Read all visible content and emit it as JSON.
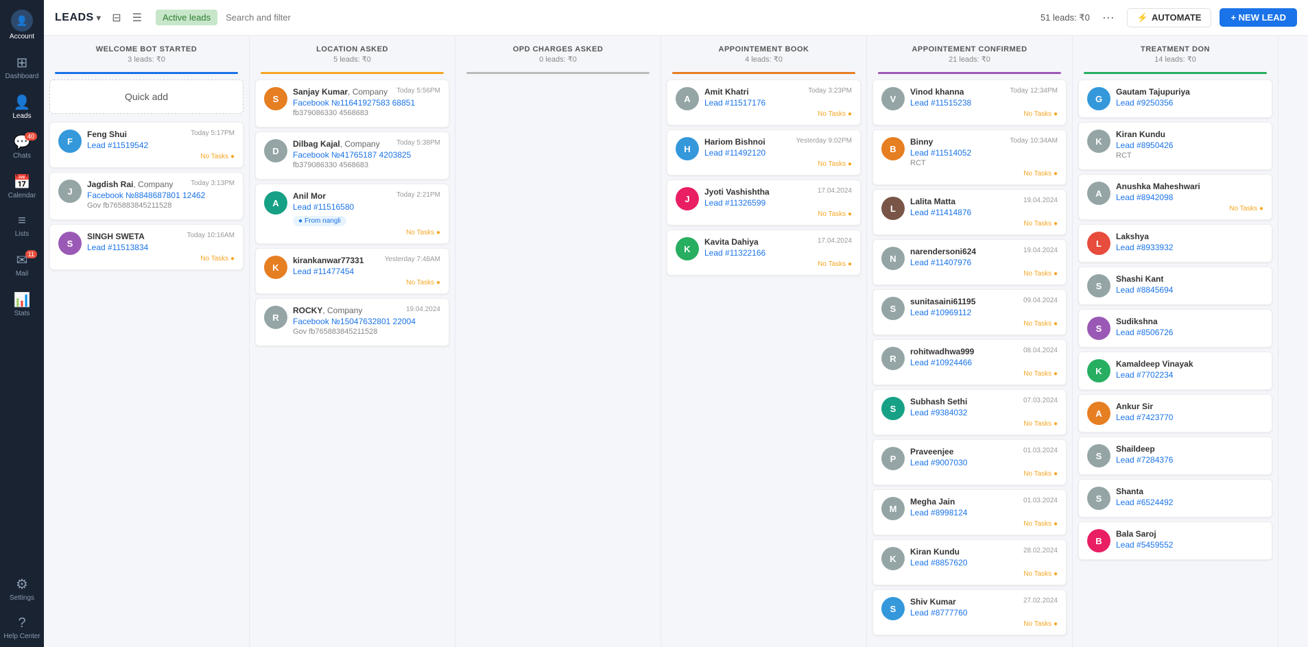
{
  "sidebar": {
    "account_label": "Account",
    "items": [
      {
        "id": "dashboard",
        "label": "Dashboard",
        "icon": "⊞"
      },
      {
        "id": "leads",
        "label": "Leads",
        "icon": "👤",
        "active": true
      },
      {
        "id": "chats",
        "label": "Chats",
        "icon": "💬",
        "badge": "40"
      },
      {
        "id": "calendar",
        "label": "Calendar",
        "icon": "📅"
      },
      {
        "id": "lists",
        "label": "Lists",
        "icon": "≡"
      },
      {
        "id": "mail",
        "label": "Mail",
        "icon": "✉",
        "badge": "11"
      },
      {
        "id": "stats",
        "label": "Stats",
        "icon": "📊"
      },
      {
        "id": "settings",
        "label": "Settings",
        "icon": "⚙"
      },
      {
        "id": "help",
        "label": "Help Center",
        "icon": "?"
      }
    ]
  },
  "topbar": {
    "title": "LEADS",
    "active_filter": "Active leads",
    "search_placeholder": "Search and filter",
    "leads_count": "51 leads: ₹0",
    "automate_label": "AUTOMATE",
    "new_lead_label": "+ NEW LEAD"
  },
  "columns": [
    {
      "id": "welcome-bot",
      "title": "WELCOME BOT STARTED",
      "subtitle": "3 leads: ₹0",
      "line_color": "#1a73e8",
      "cards": [
        {
          "type": "quick-add",
          "label": "Quick add"
        },
        {
          "name": "Feng Shui",
          "time": "Today 5:17PM",
          "lead": "Lead #11519542",
          "tasks": "No Tasks",
          "avatar_char": "F",
          "avatar_color": "av-blue"
        },
        {
          "name": "Jagdish Rai",
          "name_suffix": ", Company",
          "time": "Today 3:13PM",
          "lead": "Facebook №8848687801 12462",
          "sub": "Gov  fb765883845211528",
          "avatar_char": "J",
          "avatar_color": "av-gray"
        },
        {
          "name": "SINGH SWETA",
          "time": "Today 10:16AM",
          "lead": "Lead #11513834",
          "tasks": "No Tasks",
          "avatar_char": "S",
          "avatar_color": "av-purple",
          "has_img": true
        }
      ]
    },
    {
      "id": "location-asked",
      "title": "LOCATION ASKED",
      "subtitle": "5 leads: ₹0",
      "line_color": "#f5a623",
      "cards": [
        {
          "name": "Sanjay Kumar",
          "name_suffix": ", Company",
          "time": "Today 5:56PM",
          "lead": "Facebook №11641927583 68851",
          "sub": "fb379086330 4568683",
          "avatar_char": "S",
          "avatar_color": "av-orange"
        },
        {
          "name": "Dilbag Kajal",
          "name_suffix": ", Company",
          "time": "Today 5:38PM",
          "lead": "Facebook №41765187 4203825",
          "sub": "fb379086330 4568683",
          "avatar_char": "D",
          "avatar_color": "av-gray"
        },
        {
          "name": "Anil Mor",
          "time": "Today 2:21PM",
          "lead": "Lead #11516580",
          "tasks": "No Tasks",
          "tag": "From nangli",
          "avatar_char": "A",
          "avatar_color": "av-teal",
          "has_img": true
        },
        {
          "name": "kirankanwar77331",
          "time": "Yesterday 7:48AM",
          "lead": "Lead #11477454",
          "tasks": "No Tasks",
          "avatar_char": "K",
          "avatar_color": "av-orange",
          "has_img": true
        },
        {
          "name": "ROCKY",
          "name_suffix": ", Company",
          "time": "19.04.2024",
          "lead": "Facebook №15047632801 22004",
          "sub": "Gov  fb765883845211528",
          "avatar_char": "R",
          "avatar_color": "av-gray"
        }
      ]
    },
    {
      "id": "opd-charges",
      "title": "OPD CHARGES ASKED",
      "subtitle": "0 leads: ₹0",
      "line_color": "#bbb",
      "cards": []
    },
    {
      "id": "appointement-book",
      "title": "APPOINTEMENT BOOK",
      "subtitle": "4 leads: ₹0",
      "line_color": "#e67e22",
      "cards": [
        {
          "name": "Amit Khatri",
          "time": "Today 3:23PM",
          "lead": "Lead #11517176",
          "tasks": "No Tasks",
          "avatar_char": "A",
          "avatar_color": "av-gray"
        },
        {
          "name": "Hariom Bishnoi",
          "time": "Yesterday 9:02PM",
          "lead": "Lead #11492120",
          "tasks": "No Tasks",
          "avatar_char": "H",
          "avatar_color": "av-blue",
          "has_img": true
        },
        {
          "name": "Jyoti Vashishtha",
          "time": "17.04.2024",
          "lead": "Lead #11326599",
          "tasks": "No Tasks",
          "avatar_char": "J",
          "avatar_color": "av-pink",
          "has_img": true
        },
        {
          "name": "Kavita Dahiya",
          "time": "17.04.2024",
          "lead": "Lead #11322166",
          "tasks": "No Tasks",
          "avatar_char": "K",
          "avatar_color": "av-green",
          "has_img": true
        }
      ]
    },
    {
      "id": "appointement-confirmed",
      "title": "APPOINTEMENT CONFIRMED",
      "subtitle": "21 leads: ₹0",
      "line_color": "#9b59b6",
      "cards": [
        {
          "name": "Vinod khanna",
          "time": "Today 12:34PM",
          "lead": "Lead #11515238",
          "tasks": "No Tasks",
          "avatar_char": "V",
          "avatar_color": "av-gray"
        },
        {
          "name": "Binny",
          "time": "Today 10:34AM",
          "lead": "Lead #11514052",
          "sub": "RCT",
          "tasks": "No Tasks",
          "avatar_char": "B",
          "avatar_color": "av-orange",
          "has_img": true
        },
        {
          "name": "Lalita Matta",
          "time": "19.04.2024",
          "lead": "Lead #11414876",
          "tasks": "No Tasks",
          "avatar_char": "L",
          "avatar_color": "av-brown",
          "has_img": true
        },
        {
          "name": "narendersoni624",
          "time": "19.04.2024",
          "lead": "Lead #11407976",
          "tasks": "No Tasks",
          "avatar_char": "N",
          "avatar_color": "av-gray"
        },
        {
          "name": "sunitasaini61195",
          "time": "09.04.2024",
          "lead": "Lead #10969112",
          "tasks": "No Tasks",
          "avatar_char": "S",
          "avatar_color": "av-gray"
        },
        {
          "name": "rohitwadhwa999",
          "time": "08.04.2024",
          "lead": "Lead #10924466",
          "tasks": "No Tasks",
          "avatar_char": "R",
          "avatar_color": "av-gray"
        },
        {
          "name": "Subhash Sethi",
          "time": "07.03.2024",
          "lead": "Lead #9384032",
          "tasks": "No Tasks",
          "avatar_char": "S",
          "avatar_color": "av-teal",
          "has_img": true
        },
        {
          "name": "Praveenjee",
          "time": "01.03.2024",
          "lead": "Lead #9007030",
          "tasks": "No Tasks",
          "avatar_char": "P",
          "avatar_color": "av-gray"
        },
        {
          "name": "Megha Jain",
          "time": "01.03.2024",
          "lead": "Lead #8998124",
          "tasks": "No Tasks",
          "avatar_char": "M",
          "avatar_color": "av-gray"
        },
        {
          "name": "Kiran Kundu",
          "time": "28.02.2024",
          "lead": "Lead #8857620",
          "tasks": "No Tasks",
          "avatar_char": "K",
          "avatar_color": "av-gray"
        },
        {
          "name": "Shiv Kumar",
          "time": "27.02.2024",
          "lead": "Lead #8777760",
          "tasks": "No Tasks",
          "avatar_char": "S",
          "avatar_color": "av-blue",
          "has_img": true
        }
      ]
    },
    {
      "id": "treatment-done",
      "title": "TREATMENT DON",
      "subtitle": "14 leads: ₹0",
      "line_color": "#27ae60",
      "cards": [
        {
          "name": "Gautam Tajupuriya",
          "time": "",
          "lead": "Lead #9250356",
          "avatar_char": "G",
          "avatar_color": "av-blue",
          "has_img": true
        },
        {
          "name": "Kiran Kundu",
          "time": "",
          "lead": "Lead #8950426",
          "sub": "RCT",
          "avatar_char": "K",
          "avatar_color": "av-gray"
        },
        {
          "name": "Anushka Maheshwari",
          "time": "",
          "lead": "Lead #8942098",
          "tasks": "No Tasks",
          "avatar_char": "A",
          "avatar_color": "av-gray"
        },
        {
          "name": "Lakshya",
          "time": "",
          "lead": "Lead #8933932",
          "avatar_char": "L",
          "avatar_color": "av-red",
          "has_img": true
        },
        {
          "name": "Shashi Kant",
          "time": "",
          "lead": "Lead #8845694",
          "avatar_char": "S",
          "avatar_color": "av-gray"
        },
        {
          "name": "Sudikshna",
          "time": "",
          "lead": "Lead #8506726",
          "avatar_char": "S",
          "avatar_color": "av-purple",
          "has_img": true
        },
        {
          "name": "Kamaldeep Vinayak",
          "time": "",
          "lead": "Lead #7702234",
          "avatar_char": "K",
          "avatar_color": "av-green",
          "has_img": true
        },
        {
          "name": "Ankur Sir",
          "time": "",
          "lead": "Lead #7423770",
          "avatar_char": "A",
          "avatar_color": "av-orange",
          "has_img": true
        },
        {
          "name": "Shaildeep",
          "time": "",
          "lead": "Lead #7284376",
          "avatar_char": "S",
          "avatar_color": "av-gray"
        },
        {
          "name": "Shanta",
          "time": "",
          "lead": "Lead #6524492",
          "avatar_char": "S",
          "avatar_color": "av-gray"
        },
        {
          "name": "Bala Saroj",
          "time": "",
          "lead": "Lead #5459552",
          "avatar_char": "B",
          "avatar_color": "av-pink",
          "has_img": true
        }
      ]
    }
  ]
}
